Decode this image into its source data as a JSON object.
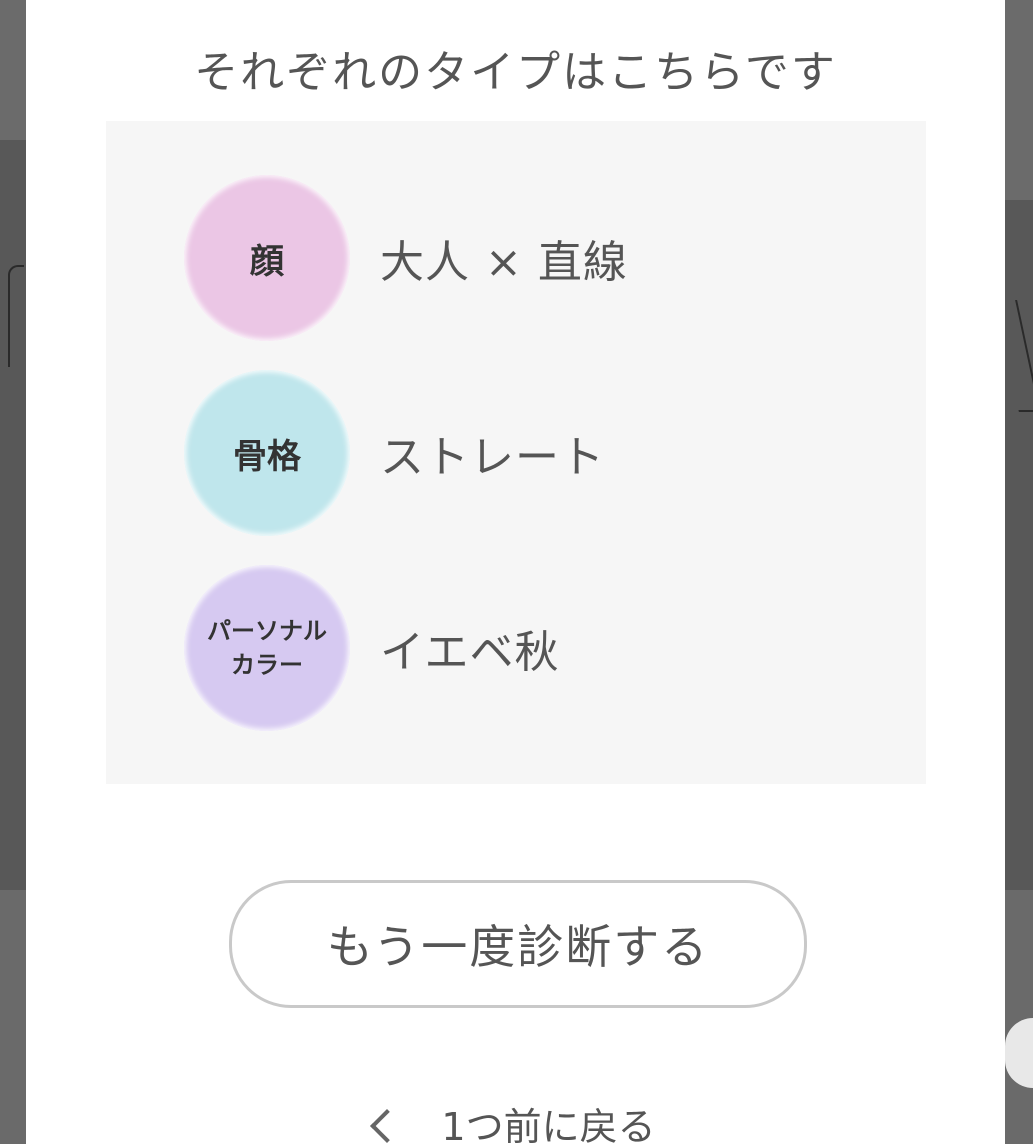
{
  "modal": {
    "title": "それぞれのタイプはこちらです"
  },
  "results": [
    {
      "badge_label": "顔",
      "value": "大人 × 直線",
      "badge_color": "#ebc6e5"
    },
    {
      "badge_label": "骨格",
      "value": "ストレート",
      "badge_color": "#bfe6ec"
    },
    {
      "badge_label_line1": "パーソナル",
      "badge_label_line2": "カラー",
      "value": "イエベ秋",
      "badge_color": "#d6c9f1"
    }
  ],
  "actions": {
    "retry_label": "もう一度診断する",
    "back_label": "1つ前に戻る"
  },
  "icons": {
    "back": "chevron-left-icon"
  }
}
